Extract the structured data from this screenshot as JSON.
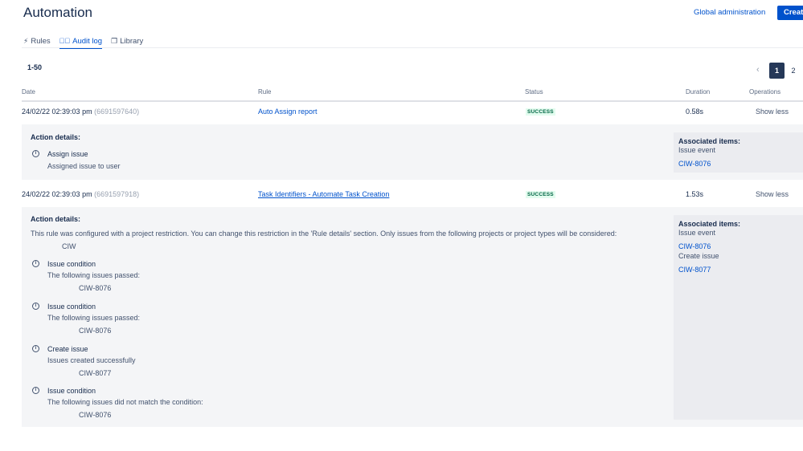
{
  "header": {
    "title": "Automation",
    "global_admin": "Global administration",
    "create": "Create"
  },
  "tabs": [
    {
      "label": "Rules",
      "icon": "lightning-icon"
    },
    {
      "label": "Audit log",
      "icon": "check-circle-icon"
    },
    {
      "label": "Library",
      "icon": "copy-icon"
    }
  ],
  "pagination": {
    "range": "1-50",
    "pages": [
      "1",
      "2"
    ],
    "current": "1"
  },
  "columns": {
    "date": "Date",
    "rule": "Rule",
    "status": "Status",
    "duration": "Duration",
    "operations": "Operations"
  },
  "rows": [
    {
      "date": "24/02/22 02:39:03 pm",
      "id": "(6691597640)",
      "rule": "Auto Assign report",
      "status": "SUCCESS",
      "duration": "0.58s",
      "operation": "Show less",
      "details_title": "Action details:",
      "actions": [
        {
          "title": "Assign issue",
          "desc": "Assigned issue to user"
        }
      ],
      "assoc": {
        "label": "Associated items:",
        "event": "Issue event",
        "link": "CIW-8076"
      }
    },
    {
      "date": "24/02/22 02:39:03 pm",
      "id": "(6691597918)",
      "rule": "Task Identifiers - Automate Task Creation",
      "status": "SUCCESS",
      "duration": "1.53s",
      "operation": "Show less",
      "details_title": "Action details:",
      "restriction": "This rule was configured with a project restriction. You can change this restriction in the 'Rule details' section. Only issues from the following projects or project types will be considered:",
      "project": "CIW",
      "actions": [
        {
          "title": "Issue condition",
          "desc": "The following issues passed:",
          "item": "CIW-8076"
        },
        {
          "title": "Issue condition",
          "desc": "The following issues passed:",
          "item": "CIW-8076"
        },
        {
          "title": "Create issue",
          "desc": "Issues created successfully",
          "item": "CIW-8077"
        },
        {
          "title": "Issue condition",
          "desc": "The following issues did not match the condition:",
          "item": "CIW-8076"
        }
      ],
      "assoc": {
        "label": "Associated items:",
        "event": "Issue event",
        "link": "CIW-8076",
        "create": "Create issue",
        "link2": "CIW-8077"
      }
    }
  ]
}
